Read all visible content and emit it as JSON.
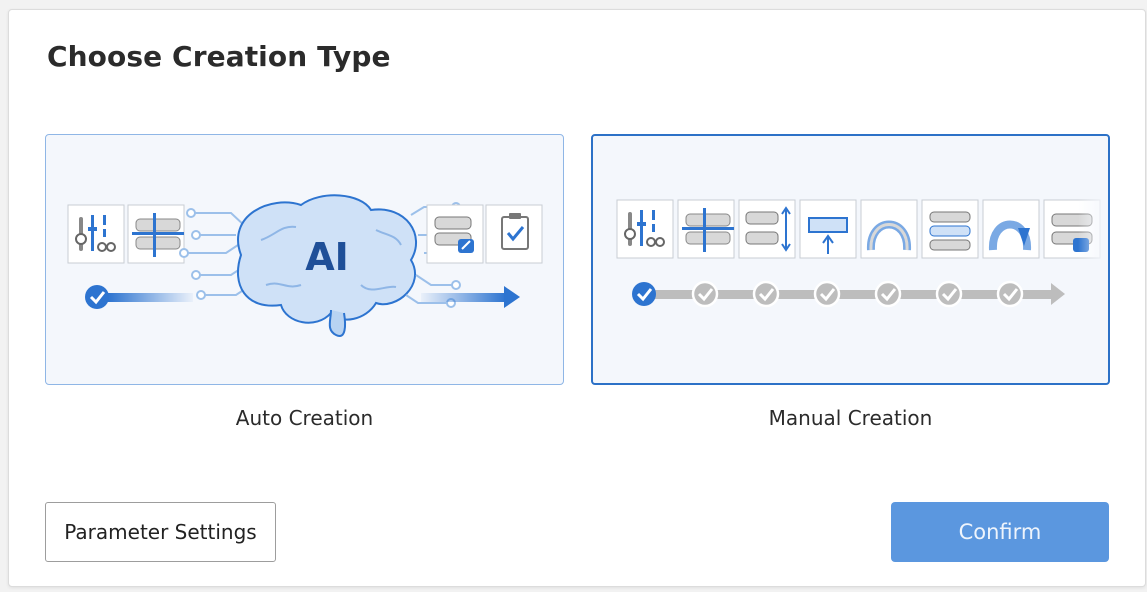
{
  "dialog": {
    "title": "Choose Creation Type"
  },
  "options": [
    {
      "label": "Auto Creation",
      "illustration_text": "AI",
      "icons": [
        "parameters-tools-icon",
        "dental-cut-icon",
        "denture-edit-icon",
        "clipboard-check-icon"
      ],
      "selected": false
    },
    {
      "label": "Manual Creation",
      "icons": [
        "parameters-tools-icon",
        "dental-cut-icon",
        "teeth-adjust-icon",
        "arch-raise-icon",
        "arch-icon",
        "teeth-stack-icon",
        "arch-trim-icon",
        "denture-icon"
      ],
      "selected": true
    }
  ],
  "buttons": {
    "parameter_settings": "Parameter Settings",
    "confirm": "Confirm"
  },
  "colors": {
    "accent": "#2c71c7",
    "card_bg": "#f4f7fc",
    "confirm_bg": "#5b97df",
    "step_done": "#2d74d0",
    "step_pending": "#bdbdbd"
  }
}
